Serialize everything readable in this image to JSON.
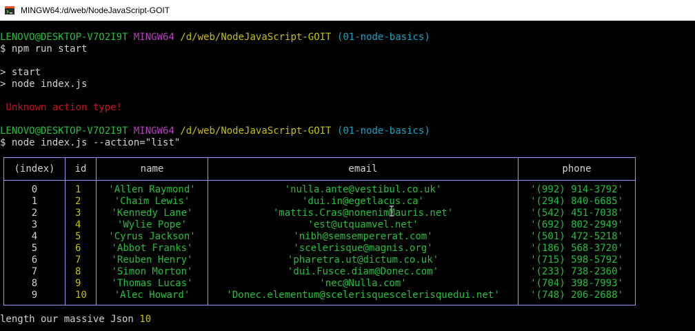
{
  "window": {
    "title": "MINGW64:/d/web/NodeJavaScript-GOIT"
  },
  "prompt1": {
    "user": "LENOVO@DESKTOP-V7O2I9T",
    "shell": "MINGW64",
    "path": "/d/web/NodeJavaScript-GOIT",
    "branch": "(01-node-basics)"
  },
  "cmd1": "$ npm run start",
  "out1": [
    "> start",
    "> node index.js"
  ],
  "error": " Unknown action type!",
  "prompt2": {
    "user": "LENOVO@DESKTOP-V7O2I9T",
    "shell": "MINGW64",
    "path": "/d/web/NodeJavaScript-GOIT",
    "branch": "(01-node-basics)"
  },
  "cmd2": "$ node index.js --action=\"list\"",
  "table": {
    "headers": [
      "(index)",
      "id",
      "name",
      "email",
      "phone"
    ],
    "rows": [
      [
        "0",
        "1",
        "'Allen Raymond'",
        "'nulla.ante@vestibul.co.uk'",
        "'(992) 914-3792'"
      ],
      [
        "1",
        "2",
        "'Chaim Lewis'",
        "'dui.in@egetlacus.ca'",
        "'(294) 840-6685'"
      ],
      [
        "2",
        "3",
        "'Kennedy Lane'",
        "'mattis.Cras@nonenimMauris.net'",
        "'(542) 451-7038'"
      ],
      [
        "3",
        "4",
        "'Wylie Pope'",
        "'est@utquamvel.net'",
        "'(692) 802-2949'"
      ],
      [
        "4",
        "5",
        "'Cyrus Jackson'",
        "'nibh@semsempererat.com'",
        "'(501) 472-5218'"
      ],
      [
        "5",
        "6",
        "'Abbot Franks'",
        "'scelerisque@magnis.org'",
        "'(186) 568-3720'"
      ],
      [
        "6",
        "7",
        "'Reuben Henry'",
        "'pharetra.ut@dictum.co.uk'",
        "'(715) 598-5792'"
      ],
      [
        "7",
        "8",
        "'Simon Morton'",
        "'dui.Fusce.diam@Donec.com'",
        "'(233) 738-2360'"
      ],
      [
        "8",
        "9",
        "'Thomas Lucas'",
        "'nec@Nulla.com'",
        "'(704) 398-7993'"
      ],
      [
        "9",
        "10",
        "'Alec Howard'",
        "'Donec.elementum@scelerisquescelerisquedui.net'",
        "'(748) 206-2688'"
      ]
    ]
  },
  "footer": {
    "label": "length our massive Json ",
    "count": "10"
  },
  "colors": {
    "green": "#24bf3a",
    "magenta": "#b93dbf",
    "yellow": "#c6c100",
    "cyan": "#14a5c4",
    "red": "#c50f1f",
    "border": "#9a9aff"
  },
  "icons": {
    "app": "git-bash-icon",
    "cursor": "ibeam-cursor-icon"
  }
}
